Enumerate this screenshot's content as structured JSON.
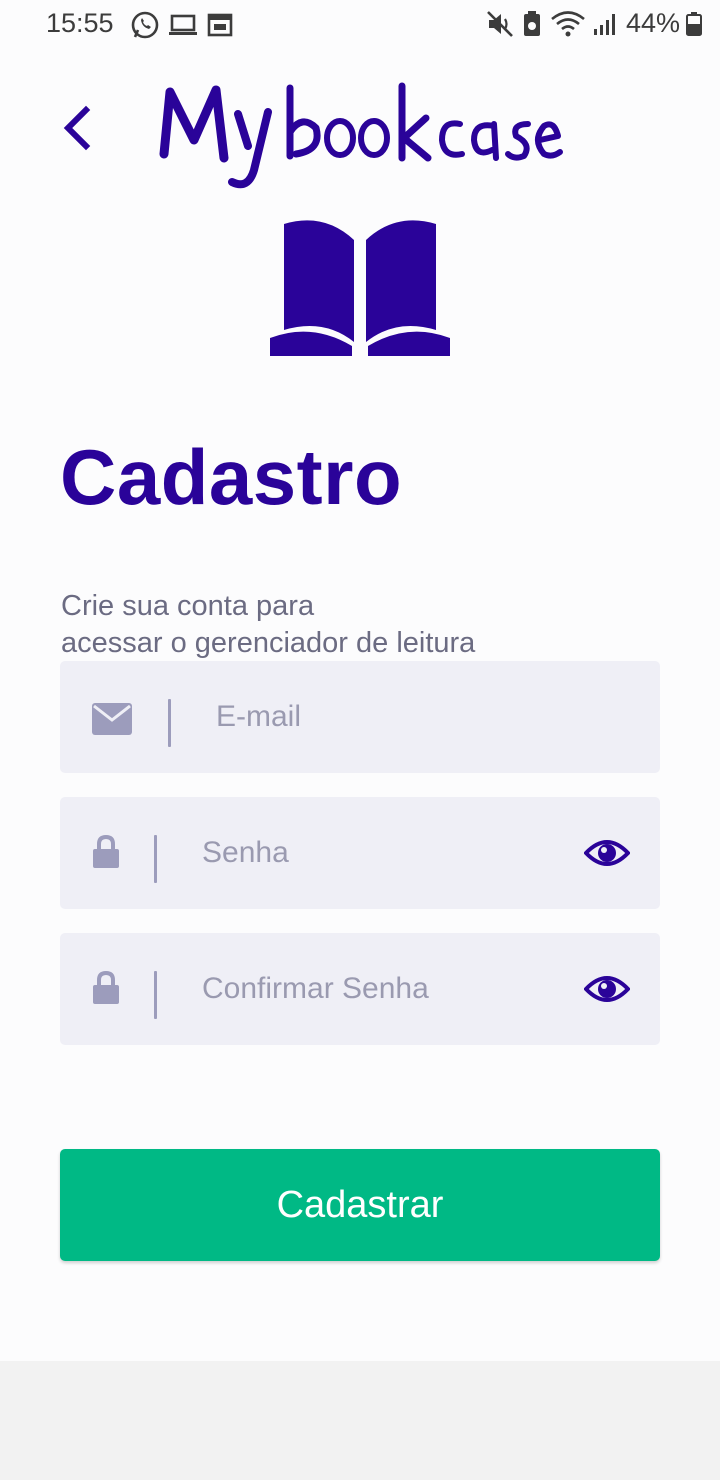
{
  "status_bar": {
    "time": "15:55",
    "battery": "44%",
    "icons": [
      "whatsapp-icon",
      "laptop-icon",
      "calendar-icon",
      "mute-icon",
      "battery-saver-icon",
      "wifi-icon",
      "signal-icon",
      "battery-icon"
    ]
  },
  "header": {
    "back_icon": "chevron-left-icon",
    "logo_text": "My bookcase",
    "logo_icon": "open-book-icon"
  },
  "page": {
    "title": "Cadastro",
    "subtitle_line1": "Crie sua conta para",
    "subtitle_line2": "acessar o gerenciador de leitura"
  },
  "form": {
    "email": {
      "placeholder": "E-mail",
      "value": "",
      "icon": "envelope-icon"
    },
    "password": {
      "placeholder": "Senha",
      "value": "",
      "icon": "lock-icon",
      "toggle_icon": "eye-icon"
    },
    "confirm_password": {
      "placeholder": "Confirmar Senha",
      "value": "",
      "icon": "lock-icon",
      "toggle_icon": "eye-icon"
    },
    "submit_label": "Cadastrar"
  },
  "colors": {
    "brand": "#2a0399",
    "button": "#00b985",
    "field_bg": "#efeff6",
    "muted_icon": "#9c9cbc"
  }
}
